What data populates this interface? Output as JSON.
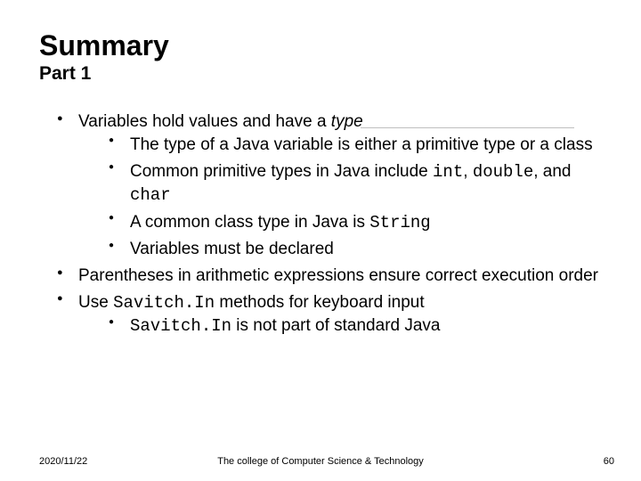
{
  "title": "Summary",
  "subtitle": "Part 1",
  "bullets": {
    "b1": {
      "pre": "Variables hold values and have a ",
      "emph": "type"
    },
    "b1a": "The type of a Java variable is either a primitive type or a class",
    "b1b": {
      "pre": "Common primitive types in Java include ",
      "c1": "int",
      "sep1": ", ",
      "c2": "double",
      "sep2": ", and ",
      "c3": "char"
    },
    "b1c": {
      "pre": "A common class type in Java is ",
      "c1": "String"
    },
    "b1d": "Variables must be declared",
    "b2": "Parentheses in arithmetic expressions ensure correct execution order",
    "b3": {
      "pre": "Use ",
      "code": "Savitch.In",
      "post": " methods for keyboard input"
    },
    "b3a": {
      "code": "Savitch.In",
      "post": " is not part of standard Java"
    }
  },
  "footer": {
    "date": "2020/11/22",
    "center": "The college of Computer Science & Technology",
    "page": "60"
  }
}
